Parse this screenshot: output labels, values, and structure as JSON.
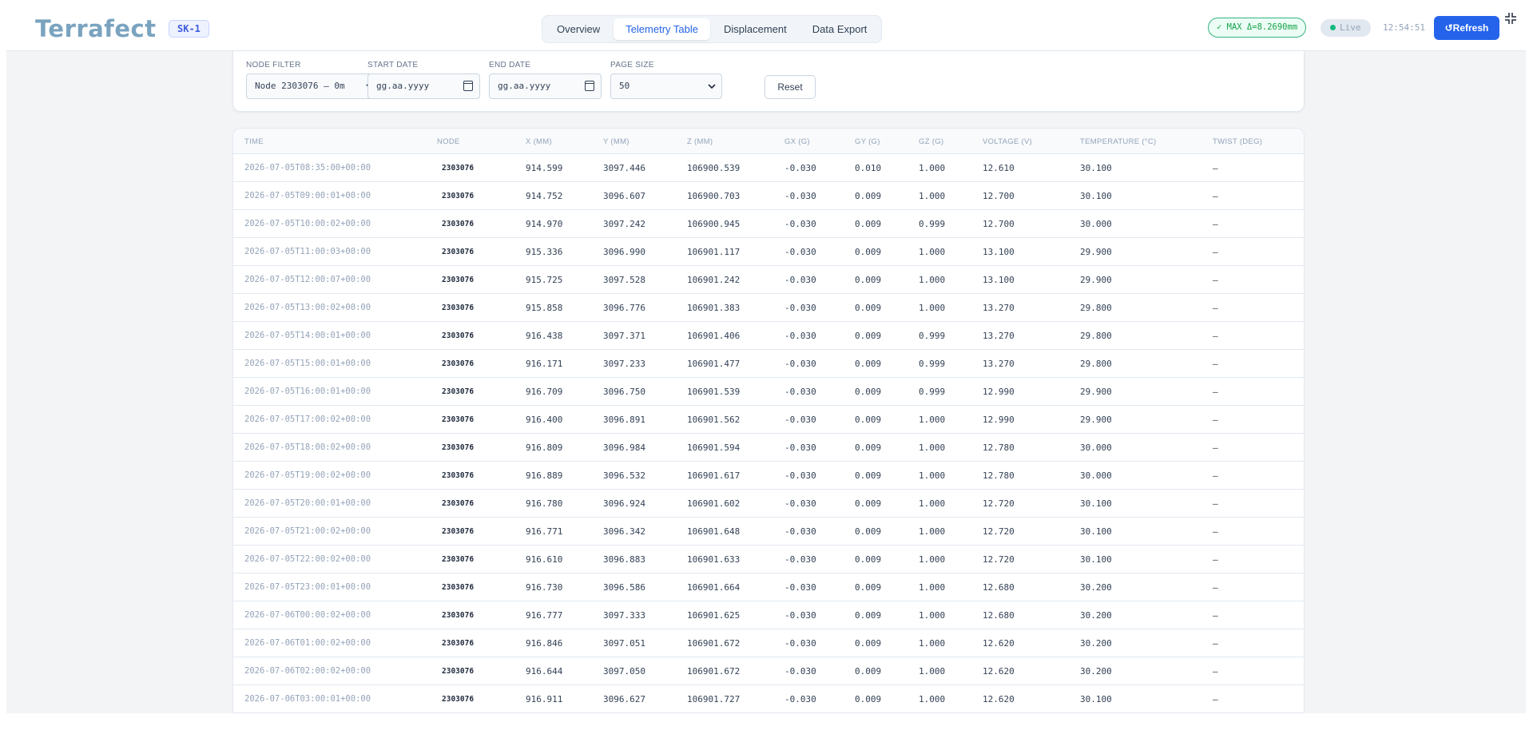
{
  "header": {
    "logo": "Terrafect",
    "site_badge": "SK-1",
    "tabs": [
      {
        "label": "Overview",
        "active": false
      },
      {
        "label": "Telemetry Table",
        "active": true
      },
      {
        "label": "Displacement",
        "active": false
      },
      {
        "label": "Data Export",
        "active": false
      }
    ],
    "max_badge": "✓ MAX Δ=8.2690mm",
    "live_label": "Live",
    "clock": "12:54:51",
    "refresh_label": "↺Refresh"
  },
  "filters": {
    "node_filter": {
      "label": "NODE FILTER",
      "value": "Node 2303076 — 0m"
    },
    "start_date": {
      "label": "START DATE",
      "placeholder": "gg.aa.yyyy"
    },
    "end_date": {
      "label": "END DATE",
      "placeholder": "gg.aa.yyyy"
    },
    "page_size": {
      "label": "PAGE SIZE",
      "value": "50"
    },
    "reset_label": "Reset"
  },
  "table": {
    "columns": [
      "TIME",
      "NODE",
      "X (MM)",
      "Y (MM)",
      "Z (MM)",
      "GX (G)",
      "GY (G)",
      "GZ (G)",
      "VOLTAGE (V)",
      "TEMPERATURE (°C)",
      "TWIST (DEG)"
    ],
    "rows": [
      [
        "2026-07-05T08:35:00+00:00",
        "2303076",
        "914.599",
        "3097.446",
        "106900.539",
        "-0.030",
        "0.010",
        "1.000",
        "12.610",
        "30.100",
        "—"
      ],
      [
        "2026-07-05T09:00:01+00:00",
        "2303076",
        "914.752",
        "3096.607",
        "106900.703",
        "-0.030",
        "0.009",
        "1.000",
        "12.700",
        "30.100",
        "—"
      ],
      [
        "2026-07-05T10:00:02+00:00",
        "2303076",
        "914.970",
        "3097.242",
        "106900.945",
        "-0.030",
        "0.009",
        "0.999",
        "12.700",
        "30.000",
        "—"
      ],
      [
        "2026-07-05T11:00:03+00:00",
        "2303076",
        "915.336",
        "3096.990",
        "106901.117",
        "-0.030",
        "0.009",
        "1.000",
        "13.100",
        "29.900",
        "—"
      ],
      [
        "2026-07-05T12:00:07+00:00",
        "2303076",
        "915.725",
        "3097.528",
        "106901.242",
        "-0.030",
        "0.009",
        "1.000",
        "13.100",
        "29.900",
        "—"
      ],
      [
        "2026-07-05T13:00:02+00:00",
        "2303076",
        "915.858",
        "3096.776",
        "106901.383",
        "-0.030",
        "0.009",
        "1.000",
        "13.270",
        "29.800",
        "—"
      ],
      [
        "2026-07-05T14:00:01+00:00",
        "2303076",
        "916.438",
        "3097.371",
        "106901.406",
        "-0.030",
        "0.009",
        "0.999",
        "13.270",
        "29.800",
        "—"
      ],
      [
        "2026-07-05T15:00:01+00:00",
        "2303076",
        "916.171",
        "3097.233",
        "106901.477",
        "-0.030",
        "0.009",
        "0.999",
        "13.270",
        "29.800",
        "—"
      ],
      [
        "2026-07-05T16:00:01+00:00",
        "2303076",
        "916.709",
        "3096.750",
        "106901.539",
        "-0.030",
        "0.009",
        "0.999",
        "12.990",
        "29.900",
        "—"
      ],
      [
        "2026-07-05T17:00:02+00:00",
        "2303076",
        "916.400",
        "3096.891",
        "106901.562",
        "-0.030",
        "0.009",
        "1.000",
        "12.990",
        "29.900",
        "—"
      ],
      [
        "2026-07-05T18:00:02+00:00",
        "2303076",
        "916.809",
        "3096.984",
        "106901.594",
        "-0.030",
        "0.009",
        "1.000",
        "12.780",
        "30.000",
        "—"
      ],
      [
        "2026-07-05T19:00:02+00:00",
        "2303076",
        "916.889",
        "3096.532",
        "106901.617",
        "-0.030",
        "0.009",
        "1.000",
        "12.780",
        "30.000",
        "—"
      ],
      [
        "2026-07-05T20:00:01+00:00",
        "2303076",
        "916.780",
        "3096.924",
        "106901.602",
        "-0.030",
        "0.009",
        "1.000",
        "12.720",
        "30.100",
        "—"
      ],
      [
        "2026-07-05T21:00:02+00:00",
        "2303076",
        "916.771",
        "3096.342",
        "106901.648",
        "-0.030",
        "0.009",
        "1.000",
        "12.720",
        "30.100",
        "—"
      ],
      [
        "2026-07-05T22:00:02+00:00",
        "2303076",
        "916.610",
        "3096.883",
        "106901.633",
        "-0.030",
        "0.009",
        "1.000",
        "12.720",
        "30.100",
        "—"
      ],
      [
        "2026-07-05T23:00:01+00:00",
        "2303076",
        "916.730",
        "3096.586",
        "106901.664",
        "-0.030",
        "0.009",
        "1.000",
        "12.680",
        "30.200",
        "—"
      ],
      [
        "2026-07-06T00:00:02+00:00",
        "2303076",
        "916.777",
        "3097.333",
        "106901.625",
        "-0.030",
        "0.009",
        "1.000",
        "12.680",
        "30.200",
        "—"
      ],
      [
        "2026-07-06T01:00:02+00:00",
        "2303076",
        "916.846",
        "3097.051",
        "106901.672",
        "-0.030",
        "0.009",
        "1.000",
        "12.620",
        "30.200",
        "—"
      ],
      [
        "2026-07-06T02:00:02+00:00",
        "2303076",
        "916.644",
        "3097.050",
        "106901.672",
        "-0.030",
        "0.009",
        "1.000",
        "12.620",
        "30.200",
        "—"
      ],
      [
        "2026-07-06T03:00:01+00:00",
        "2303076",
        "916.911",
        "3096.627",
        "106901.727",
        "-0.030",
        "0.009",
        "1.000",
        "12.620",
        "30.100",
        "—"
      ]
    ]
  },
  "colors": {
    "accent": "#2563eb",
    "success": "#16a34a",
    "logo": "#7aa3bf"
  }
}
